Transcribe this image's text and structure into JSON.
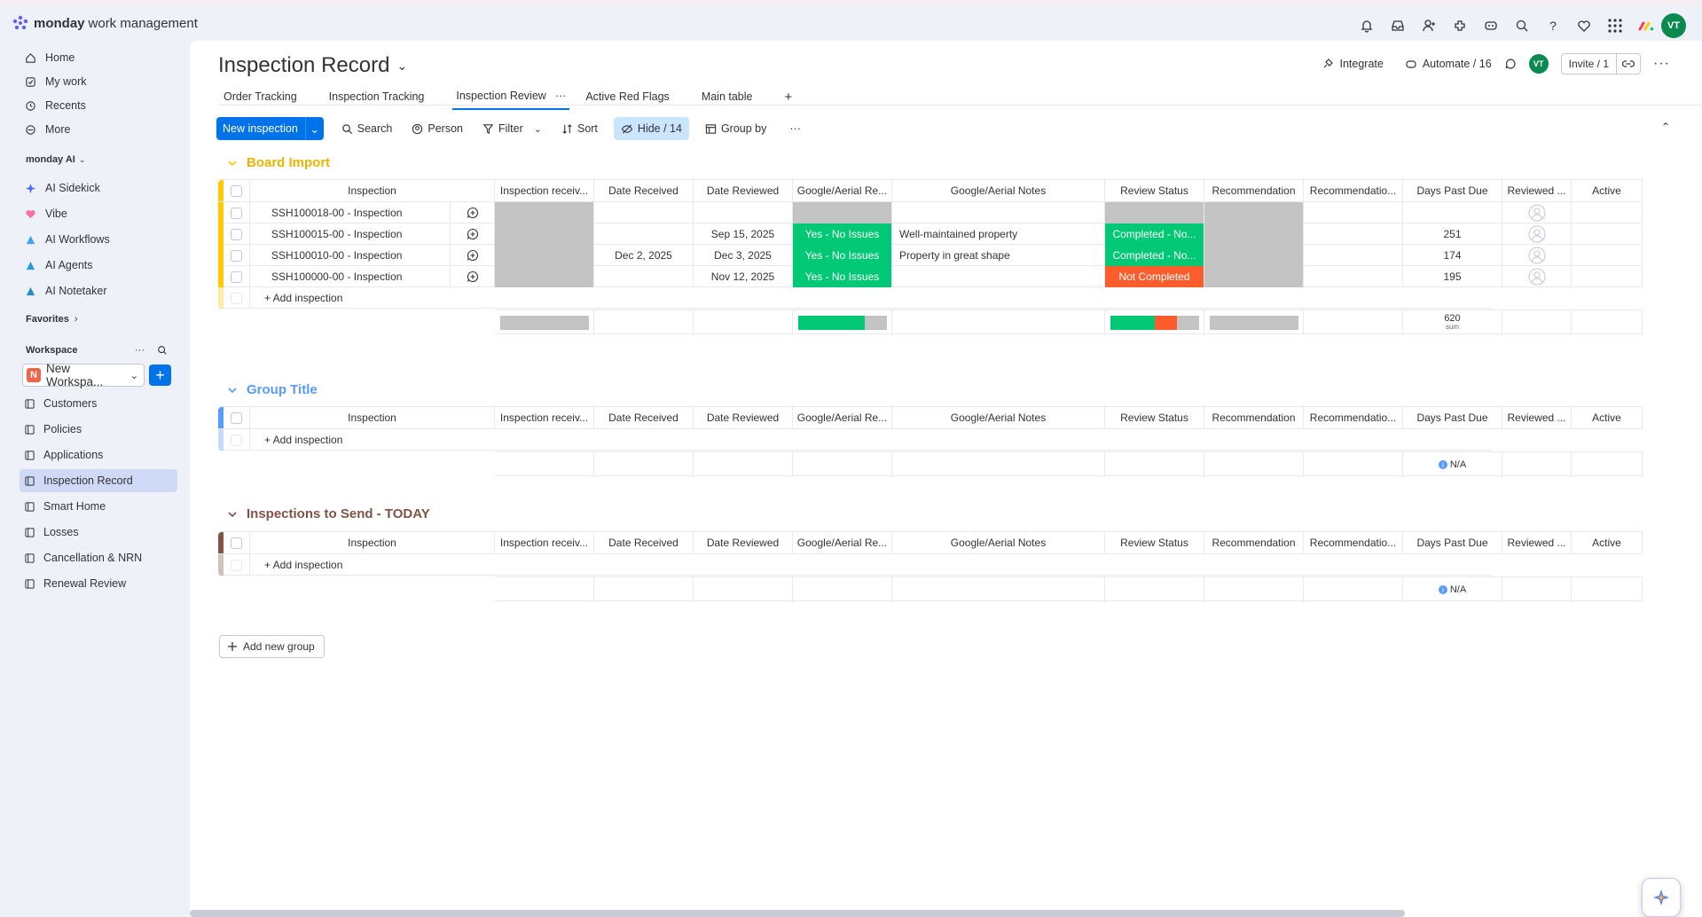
{
  "app": {
    "brand": "monday",
    "product": "work management"
  },
  "user": {
    "initials": "VT"
  },
  "sidebar": {
    "nav": [
      {
        "label": "Home",
        "icon": "home-icon"
      },
      {
        "label": "My work",
        "icon": "my-work-icon"
      },
      {
        "label": "Recents",
        "icon": "clock-icon"
      },
      {
        "label": "More",
        "icon": "more-icon"
      }
    ],
    "ai_section": "monday AI",
    "ai_items": [
      "AI Sidekick",
      "Vibe",
      "AI Workflows",
      "AI Agents",
      "AI Notetaker"
    ],
    "favorites": "Favorites",
    "workspace_label": "Workspace",
    "workspace_tag": "N",
    "workspace_name": "New Workspa...",
    "boards": [
      "Customers",
      "Policies",
      "Applications",
      "Inspection Record",
      "Smart Home",
      "Losses",
      "Cancellation & NRN",
      "Renewal Review"
    ],
    "active_board": "Inspection Record"
  },
  "board": {
    "title": "Inspection Record",
    "tabs": [
      "Order Tracking",
      "Inspection Tracking",
      "Inspection Review",
      "Active Red Flags",
      "Main table"
    ],
    "active_tab": "Inspection Review",
    "integrate": "Integrate",
    "automate": "Automate / 16",
    "invite": "Invite / 1"
  },
  "toolbar": {
    "new_item": "New inspection",
    "search": "Search",
    "person": "Person",
    "filter": "Filter",
    "sort": "Sort",
    "hide": "Hide / 14",
    "group_by": "Group by"
  },
  "columns": [
    "Inspection",
    "Inspection receiv...",
    "Date Received",
    "Date Reviewed",
    "Google/Aerial Re...",
    "Google/Aerial Notes",
    "Review Status",
    "Recommendation",
    "Recommendatio...",
    "Days Past Due",
    "Reviewed ...",
    "Active"
  ],
  "groups": [
    {
      "title": "Board Import",
      "color": "#ffcb00",
      "title_color": "#e8b400",
      "rows": [
        {
          "name": "SSH100018-00 - Inspection",
          "date_received": "",
          "date_reviewed": "",
          "google": "",
          "notes": "",
          "status": "",
          "days": ""
        },
        {
          "name": "SSH100015-00 - Inspection",
          "date_received": "",
          "date_reviewed": "Sep 15, 2025",
          "google": "Yes - No Issues",
          "notes": "Well-maintained property",
          "status": "Completed - No...",
          "days": "251"
        },
        {
          "name": "SSH100010-00 - Inspection",
          "date_received": "Dec 2, 2025",
          "date_reviewed": "Dec 3, 2025",
          "google": "Yes - No Issues",
          "notes": "Property in great shape",
          "status": "Completed - No...",
          "days": "174"
        },
        {
          "name": "SSH100000-00 - Inspection",
          "date_received": "",
          "date_reviewed": "Nov 12, 2025",
          "google": "Yes - No Issues",
          "notes": "",
          "status": "Not Completed",
          "days": "195"
        }
      ],
      "add_label": "+ Add inspection",
      "summary": {
        "days_value": "620",
        "days_label": "sum",
        "google_green_fraction": 0.75,
        "status_green_fraction": 0.5,
        "status_red_fraction": 0.25
      }
    },
    {
      "title": "Group Title",
      "color": "#579bfc",
      "title_color": "#579bfc",
      "rows": [],
      "add_label": "+ Add inspection",
      "summary": {
        "days_value": "N/A"
      }
    },
    {
      "title": "Inspections to Send - TODAY",
      "color": "#7f5347",
      "title_color": "#7f5347",
      "rows": [],
      "add_label": "+ Add inspection",
      "summary": {
        "days_value": "N/A"
      }
    }
  ],
  "add_group": "Add new group"
}
